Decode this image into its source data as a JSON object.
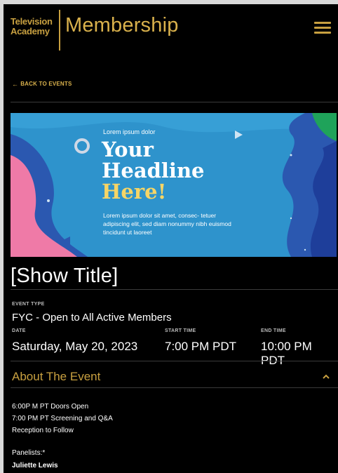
{
  "header": {
    "logo_line1": "Television",
    "logo_line2": "Academy",
    "brand_title": "Membership",
    "menu_icon": "hamburger-menu-icon",
    "accent_color": "#c8a040"
  },
  "nav": {
    "back_label": "BACK TO EVENTS",
    "back_icon": "arrow-left-icon"
  },
  "banner": {
    "kicker": "Lorem ipsum dolor",
    "headline_line1": "Your",
    "headline_line2": "Headline",
    "headline_line3": "Here!",
    "body": "Lorem ipsum dolor sit amet, consec- tetuer adipiscing elit, sed diam nonummy nibh euismod tincidunt ut laoreet",
    "background_color": "#2e93cc",
    "highlight_color": "#f6d566"
  },
  "event": {
    "show_title": "[Show Title]",
    "event_type_label": "EVENT TYPE",
    "event_type_value": "FYC - Open to All Active Members",
    "date_label": "DATE",
    "date_value": "Saturday, May 20, 2023",
    "start_label": "START TIME",
    "start_value": "7:00 PM PDT",
    "end_label": "END TIME",
    "end_value": "10:00 PM PDT"
  },
  "about": {
    "title": "About The Event",
    "toggle_icon": "chevron-up-icon",
    "line1": "6:00P M PT Doors Open",
    "line2": "7:00 PM PT Screening and Q&A",
    "line3": "Reception to Follow",
    "panelists_label": "Panelists:*",
    "panelist1": "Juliette Lewis"
  }
}
